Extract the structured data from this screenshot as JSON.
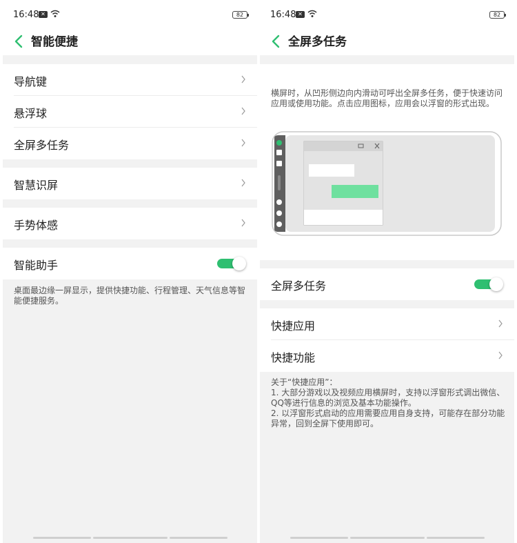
{
  "status_bar": {
    "time": "16:48",
    "battery": "82"
  },
  "left_screen": {
    "title": "智能便捷",
    "group1": [
      "导航键",
      "悬浮球",
      "全屏多任务"
    ],
    "item_smart_screen": "智慧识屏",
    "item_gesture": "手势体感",
    "item_assistant": "智能助手",
    "assistant_on": true,
    "assistant_desc": "桌面最边缘一屏显示，提供快捷功能、行程管理、天气信息等智能便捷服务。"
  },
  "right_screen": {
    "title": "全屏多任务",
    "intro": "横屏时，从凹形侧边向内滑动可呼出全屏多任务，便于快速访问应用或使用功能。点击应用图标，应用会以浮窗的形式出现。",
    "toggle_label": "全屏多任务",
    "toggle_on": true,
    "items": [
      "快捷应用",
      "快捷功能"
    ],
    "notes_title": "关于“快捷应用”：",
    "note1": "1. 大部分游戏以及视频应用横屏时，支持以浮窗形式调出微信、QQ等进行信息的浏览及基本功能操作。",
    "note2": "2. 以浮窗形式启动的应用需要应用自身支持，可能存在部分功能异常，回到全屏下使用即可。"
  },
  "colors": {
    "accent": "#2fbf71",
    "background": "#f2f2f2"
  }
}
